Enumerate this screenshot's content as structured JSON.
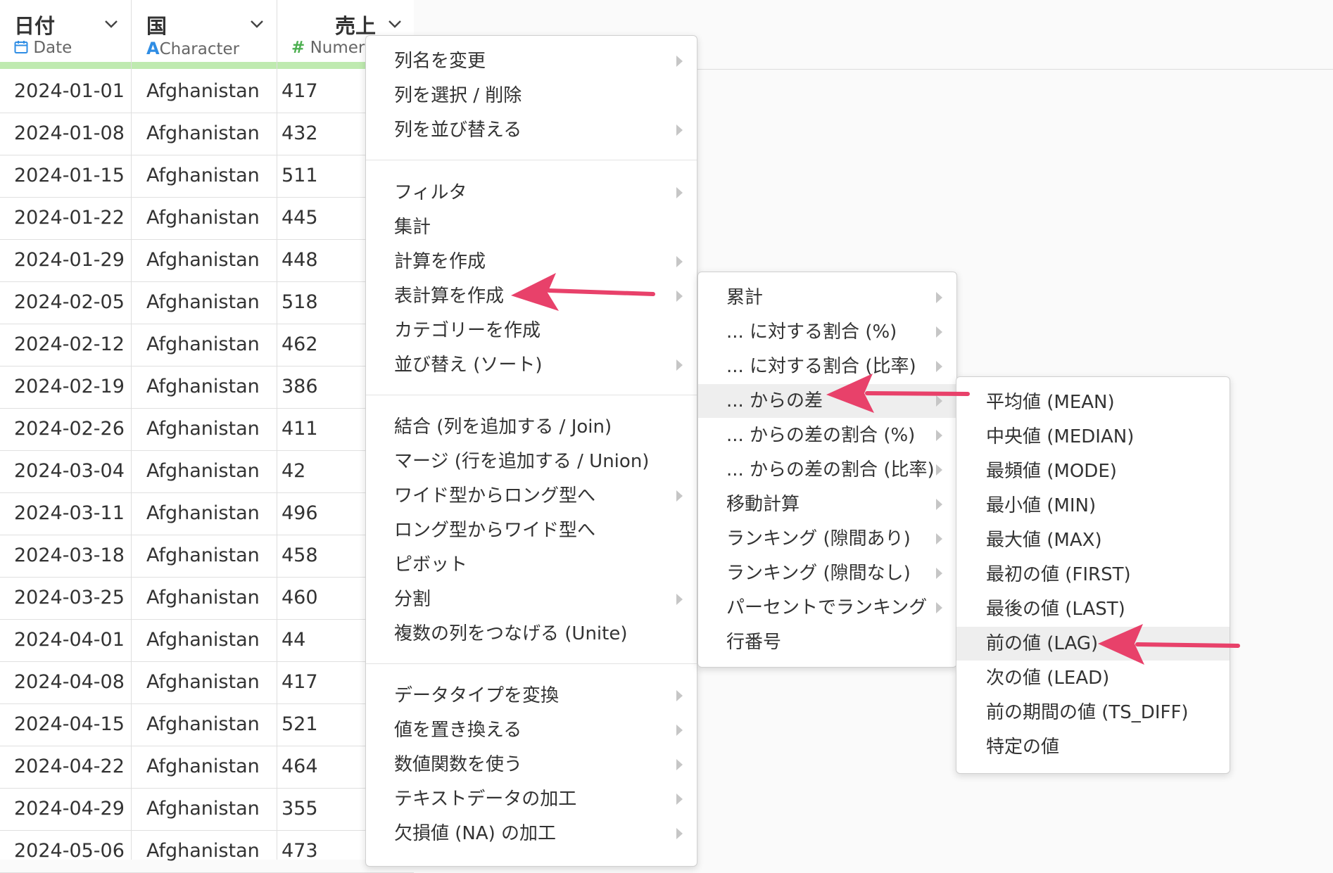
{
  "columns": [
    {
      "name": "日付",
      "type": "Date",
      "type_icon": "calendar-icon"
    },
    {
      "name": "国",
      "type": "Character",
      "type_icon": "character-a-icon"
    },
    {
      "name": "売上",
      "type": "Numeric",
      "type_icon": "hash-icon"
    }
  ],
  "rows": [
    {
      "date": "2024-01-01",
      "country": "Afghanistan",
      "sales": "417"
    },
    {
      "date": "2024-01-08",
      "country": "Afghanistan",
      "sales": "432"
    },
    {
      "date": "2024-01-15",
      "country": "Afghanistan",
      "sales": "511"
    },
    {
      "date": "2024-01-22",
      "country": "Afghanistan",
      "sales": "445"
    },
    {
      "date": "2024-01-29",
      "country": "Afghanistan",
      "sales": "448"
    },
    {
      "date": "2024-02-05",
      "country": "Afghanistan",
      "sales": "518"
    },
    {
      "date": "2024-02-12",
      "country": "Afghanistan",
      "sales": "462"
    },
    {
      "date": "2024-02-19",
      "country": "Afghanistan",
      "sales": "386"
    },
    {
      "date": "2024-02-26",
      "country": "Afghanistan",
      "sales": "411"
    },
    {
      "date": "2024-03-04",
      "country": "Afghanistan",
      "sales": "42"
    },
    {
      "date": "2024-03-11",
      "country": "Afghanistan",
      "sales": "496"
    },
    {
      "date": "2024-03-18",
      "country": "Afghanistan",
      "sales": "458"
    },
    {
      "date": "2024-03-25",
      "country": "Afghanistan",
      "sales": "460"
    },
    {
      "date": "2024-04-01",
      "country": "Afghanistan",
      "sales": "44"
    },
    {
      "date": "2024-04-08",
      "country": "Afghanistan",
      "sales": "417"
    },
    {
      "date": "2024-04-15",
      "country": "Afghanistan",
      "sales": "521"
    },
    {
      "date": "2024-04-22",
      "country": "Afghanistan",
      "sales": "464"
    },
    {
      "date": "2024-04-29",
      "country": "Afghanistan",
      "sales": "355"
    },
    {
      "date": "2024-05-06",
      "country": "Afghanistan",
      "sales": "473"
    }
  ],
  "menu_main": {
    "items": [
      {
        "label": "列名を変更",
        "submenu": true
      },
      {
        "label": "列を選択 / 削除",
        "submenu": false
      },
      {
        "label": "列を並び替える",
        "submenu": true
      },
      {
        "label": "フィルタ",
        "submenu": true
      },
      {
        "label": "集計",
        "submenu": false
      },
      {
        "label": "計算を作成",
        "submenu": true
      },
      {
        "label": "表計算を作成",
        "submenu": true
      },
      {
        "label": "カテゴリーを作成",
        "submenu": false
      },
      {
        "label": "並び替え (ソート)",
        "submenu": true
      },
      {
        "label": "結合 (列を追加する / Join)",
        "submenu": false
      },
      {
        "label": "マージ (行を追加する / Union)",
        "submenu": false
      },
      {
        "label": "ワイド型からロング型へ",
        "submenu": true
      },
      {
        "label": "ロング型からワイド型へ",
        "submenu": false
      },
      {
        "label": "ピボット",
        "submenu": false
      },
      {
        "label": "分割",
        "submenu": true
      },
      {
        "label": "複数の列をつなげる (Unite)",
        "submenu": false
      },
      {
        "label": "データタイプを変換",
        "submenu": true
      },
      {
        "label": "値を置き換える",
        "submenu": true
      },
      {
        "label": "数値関数を使う",
        "submenu": true
      },
      {
        "label": "テキストデータの加工",
        "submenu": true
      },
      {
        "label": "欠損値 (NA) の加工",
        "submenu": true
      }
    ]
  },
  "menu_table_calc": {
    "items": [
      {
        "label": "累計",
        "submenu": true
      },
      {
        "label": "... に対する割合 (%)",
        "submenu": true
      },
      {
        "label": "... に対する割合 (比率)",
        "submenu": true
      },
      {
        "label": "... からの差",
        "submenu": true
      },
      {
        "label": "... からの差の割合 (%)",
        "submenu": true
      },
      {
        "label": "... からの差の割合 (比率)",
        "submenu": true
      },
      {
        "label": "移動計算",
        "submenu": true
      },
      {
        "label": "ランキング (隙間あり)",
        "submenu": true
      },
      {
        "label": "ランキング (隙間なし)",
        "submenu": true
      },
      {
        "label": "パーセントでランキング",
        "submenu": true
      },
      {
        "label": "行番号",
        "submenu": false
      }
    ]
  },
  "menu_diff_from": {
    "items": [
      {
        "label": "平均値 (MEAN)"
      },
      {
        "label": "中央値 (MEDIAN)"
      },
      {
        "label": "最頻値 (MODE)"
      },
      {
        "label": "最小値 (MIN)"
      },
      {
        "label": "最大値 (MAX)"
      },
      {
        "label": "最初の値 (FIRST)"
      },
      {
        "label": "最後の値 (LAST)"
      },
      {
        "label": "前の値 (LAG)"
      },
      {
        "label": "次の値 (LEAD)"
      },
      {
        "label": "前の期間の値 (TS_DIFF)"
      },
      {
        "label": "特定の値"
      }
    ]
  },
  "colors": {
    "date_icon": "#2f8de4",
    "character_icon": "#2f8de4",
    "numeric_icon": "#4caf50",
    "header_bar": "#bfeab0",
    "pointer_arrow": "#e8416a"
  }
}
